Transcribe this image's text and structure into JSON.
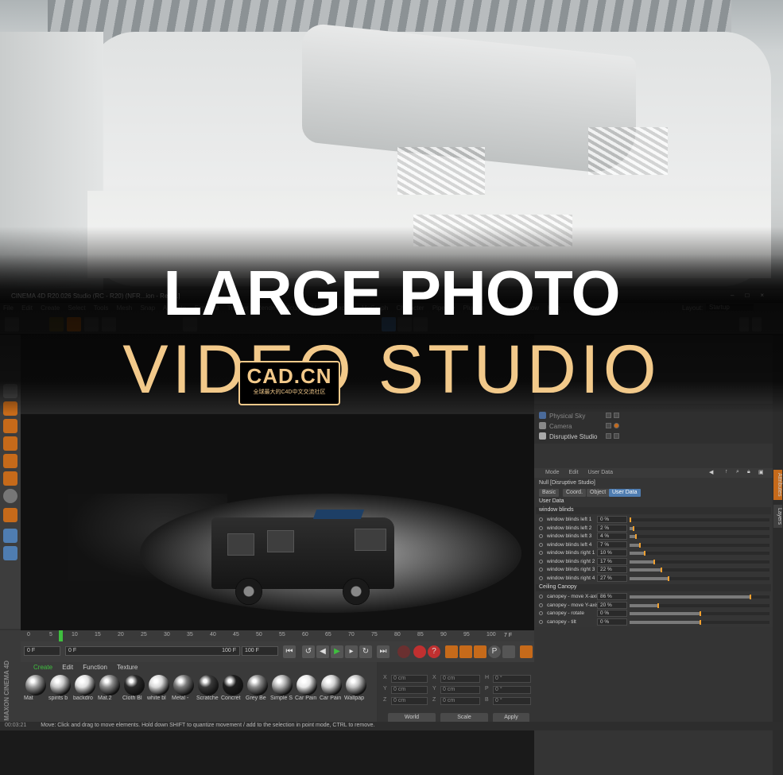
{
  "headline": {
    "line1": "LARGE PHOTO",
    "line2": "VIDEO STUDIO"
  },
  "watermark": {
    "brand": "CAD.CN",
    "tagline": "全球最大的C4D中文交流社区"
  },
  "app": {
    "title": "CINEMA 4D R20.026 Studio (RC - R20) (NFR...ion - Rest...]",
    "window_controls": [
      "–",
      "□",
      "×"
    ],
    "menu": [
      "File",
      "Edit",
      "Create",
      "Select",
      "Tools",
      "Mesh",
      "Snap",
      "Animate",
      "Simulate",
      "Tracker",
      "Render",
      "Sculpt",
      "Motion Tracker",
      "MoGraph",
      "Character",
      "Pipeline",
      "Plugins",
      "Script",
      "Window",
      "Help"
    ],
    "layout_label": "Layout:",
    "layout_value": "Startup"
  },
  "object_manager": {
    "items": [
      {
        "name": "Physical Sky"
      },
      {
        "name": "Camera"
      },
      {
        "name": "Disruptive Studio"
      }
    ]
  },
  "attributes": {
    "tabs": [
      "Mode",
      "Edit",
      "User Data"
    ],
    "object_title": "Null [Disruptive Studio]",
    "segments": [
      "Basic",
      "Coord.",
      "Object",
      "User Data"
    ],
    "active_segment": "User Data",
    "group_label": "User Data",
    "sections": [
      {
        "title": "window blinds",
        "params": [
          {
            "label": "window blinds left 1",
            "value": "0 %",
            "level": 0
          },
          {
            "label": "window blinds left 2",
            "value": "2 %",
            "level": 2
          },
          {
            "label": "window blinds left 3",
            "value": "4 %",
            "level": 4
          },
          {
            "label": "window blinds left 4",
            "value": "7 %",
            "level": 7
          },
          {
            "label": "window blinds right 1",
            "value": "10 %",
            "level": 10
          },
          {
            "label": "window blinds right 2",
            "value": "17 %",
            "level": 17
          },
          {
            "label": "window blinds right 3",
            "value": "22 %",
            "level": 22
          },
          {
            "label": "window blinds right 4",
            "value": "27 %",
            "level": 27
          }
        ]
      },
      {
        "title": "Ceiling Canopy",
        "params": [
          {
            "label": "canopey - move X-axis",
            "value": "86 %",
            "level": 86
          },
          {
            "label": "canopey - move Y-axis",
            "value": "20 %",
            "level": 20
          },
          {
            "label": "canopey - rotate",
            "value": "0 %",
            "level": 50
          },
          {
            "label": "canopey - tilt",
            "value": "0 %",
            "level": 50
          }
        ]
      }
    ]
  },
  "side_tabs": [
    "Attributes",
    "Layers"
  ],
  "timeline": {
    "ticks": [
      "0",
      "5",
      "10",
      "15",
      "20",
      "25",
      "30",
      "35",
      "40",
      "45",
      "50",
      "55",
      "60",
      "65",
      "70",
      "75",
      "80",
      "85",
      "90",
      "95",
      "100"
    ],
    "end_frame": "7 F",
    "current": "7"
  },
  "playback": {
    "start": "0 F",
    "field2": "0 F",
    "end": "100 F",
    "end2": "100 F"
  },
  "materials": {
    "menu": [
      "Create",
      "Edit",
      "Function",
      "Texture"
    ],
    "items": [
      {
        "name": "Mat",
        "color": "#9a9a9a"
      },
      {
        "name": "spirits b",
        "color": "#c8c8c8"
      },
      {
        "name": "backdro",
        "color": "#e0e0e0"
      },
      {
        "name": "Mat.2",
        "color": "#8a8a8a"
      },
      {
        "name": "Cloth Bl",
        "color": "#2a2a2a"
      },
      {
        "name": "white bl",
        "color": "#d8d8d8"
      },
      {
        "name": "Metal -",
        "color": "#7a7a7a"
      },
      {
        "name": "Scratche",
        "color": "#3a3a3a"
      },
      {
        "name": "Concret",
        "color": "#1e1e1e"
      },
      {
        "name": "Grey Be",
        "color": "#888888"
      },
      {
        "name": "Simple S",
        "color": "#b0b0b0"
      },
      {
        "name": "Car Pain",
        "color": "#e8e8e8"
      },
      {
        "name": "Car Pain",
        "color": "#d0d0d0"
      },
      {
        "name": "Wallpap",
        "color": "#c0c0c0"
      }
    ]
  },
  "coordinates": {
    "rows": [
      {
        "axis": "X",
        "pos": "0 cm",
        "axis2": "X",
        "size": "0 cm",
        "rot_axis": "H",
        "rot": "0 °"
      },
      {
        "axis": "Y",
        "pos": "0 cm",
        "axis2": "Y",
        "size": "0 cm",
        "rot_axis": "P",
        "rot": "0 °"
      },
      {
        "axis": "Z",
        "pos": "0 cm",
        "axis2": "Z",
        "size": "0 cm",
        "rot_axis": "B",
        "rot": "0 °"
      }
    ],
    "mode1": "World",
    "mode2": "Scale",
    "apply": "Apply"
  },
  "branding": "MAXON CINEMA 4D",
  "status": {
    "time": "00:03:21",
    "message": "Move: Click and drag to move elements. Hold down SHIFT to quantize movement / add to the selection in point mode, CTRL to remove."
  },
  "colors": {
    "accent_gold": "#f2c98a",
    "c4d_blue": "#4f7db1",
    "c4d_orange": "#c66a1a",
    "knob": "#f0a030"
  }
}
